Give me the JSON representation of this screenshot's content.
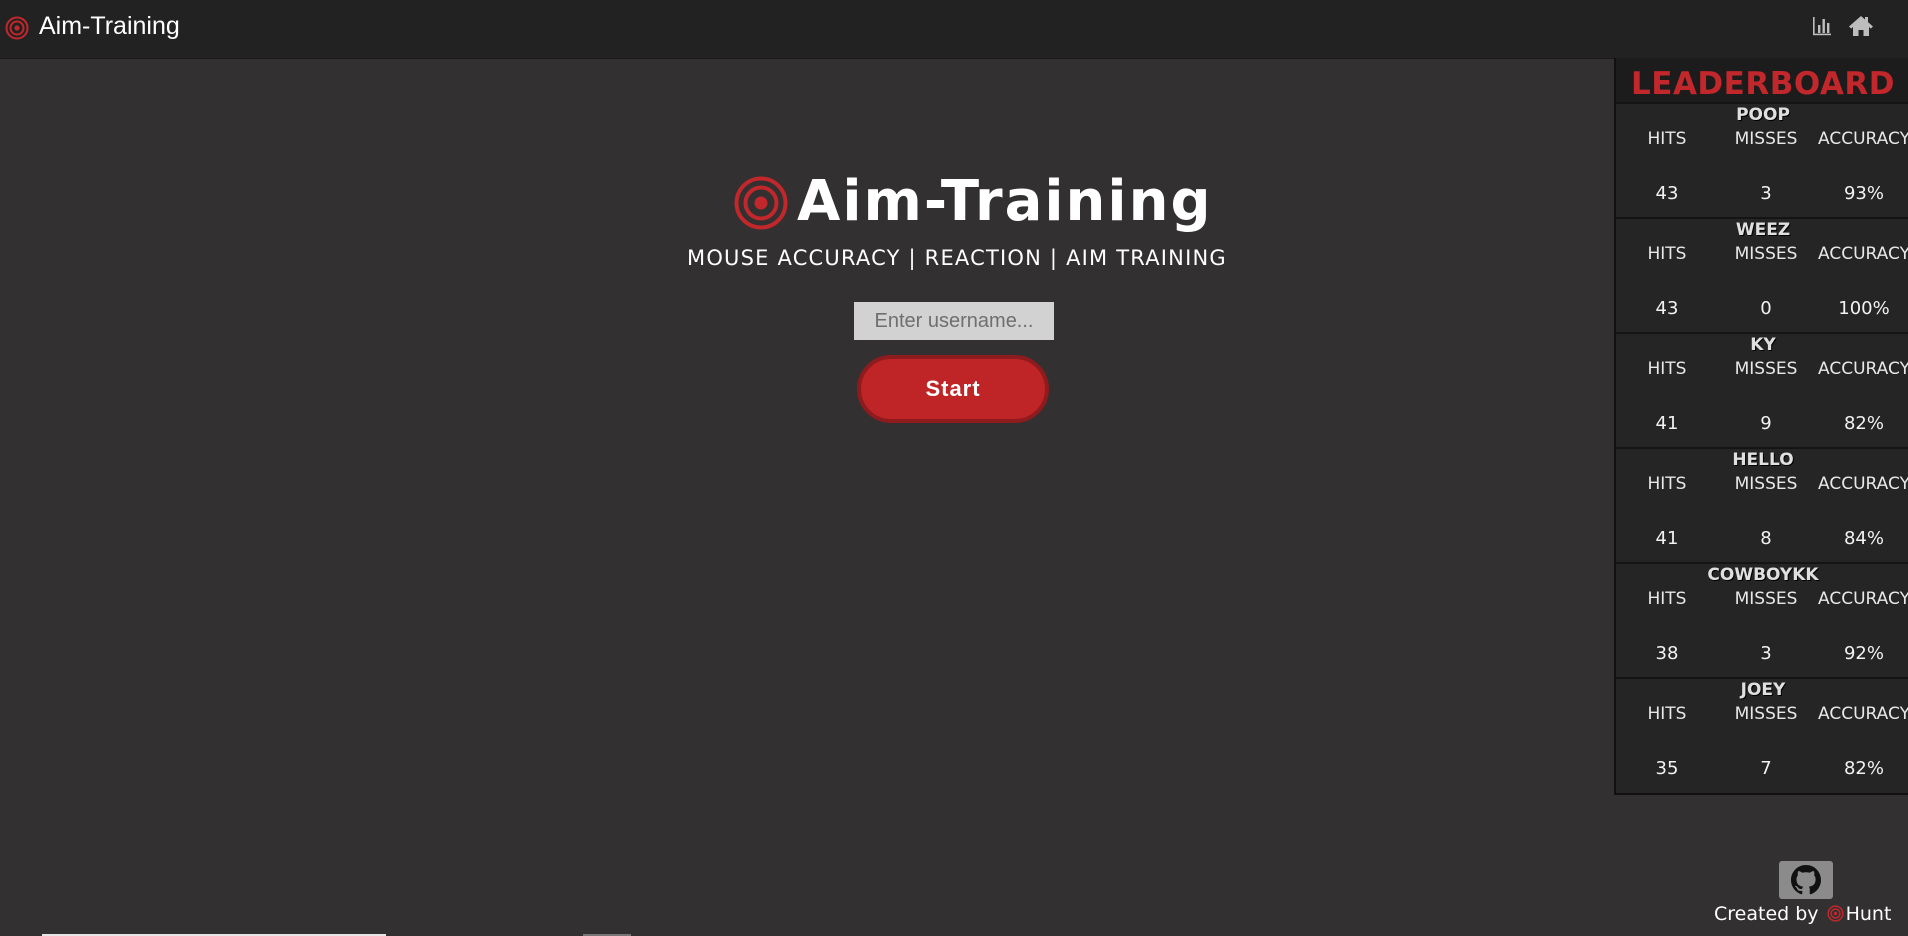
{
  "navbar": {
    "title": "Aim-Training",
    "icons": [
      "target-logo-icon",
      "bar-chart-icon",
      "home-icon"
    ]
  },
  "hero": {
    "title": "Aim-Training",
    "subtitle": "MOUSE ACCURACY | REACTION | AIM TRAINING"
  },
  "form": {
    "username_placeholder": "Enter username...",
    "username_value": "",
    "start_label": "Start"
  },
  "leaderboard": {
    "title": "LEADERBOARD",
    "headers": {
      "hits": "HITS",
      "misses": "MISSES",
      "accuracy": "ACCURACY"
    },
    "entries": [
      {
        "name": "POOP",
        "hits": "43",
        "misses": "3",
        "accuracy": "93%"
      },
      {
        "name": "WEEZ",
        "hits": "43",
        "misses": "0",
        "accuracy": "100%"
      },
      {
        "name": "KY",
        "hits": "41",
        "misses": "9",
        "accuracy": "82%"
      },
      {
        "name": "HELLO",
        "hits": "41",
        "misses": "8",
        "accuracy": "84%"
      },
      {
        "name": "COWBOYKK",
        "hits": "38",
        "misses": "3",
        "accuracy": "92%"
      },
      {
        "name": "JOEY",
        "hits": "35",
        "misses": "7",
        "accuracy": "82%"
      }
    ]
  },
  "footer": {
    "created_by": "Created by",
    "author": "Hunt"
  },
  "colors": {
    "accent": "#bf2427",
    "background": "#323031",
    "navbar": "#232222"
  }
}
